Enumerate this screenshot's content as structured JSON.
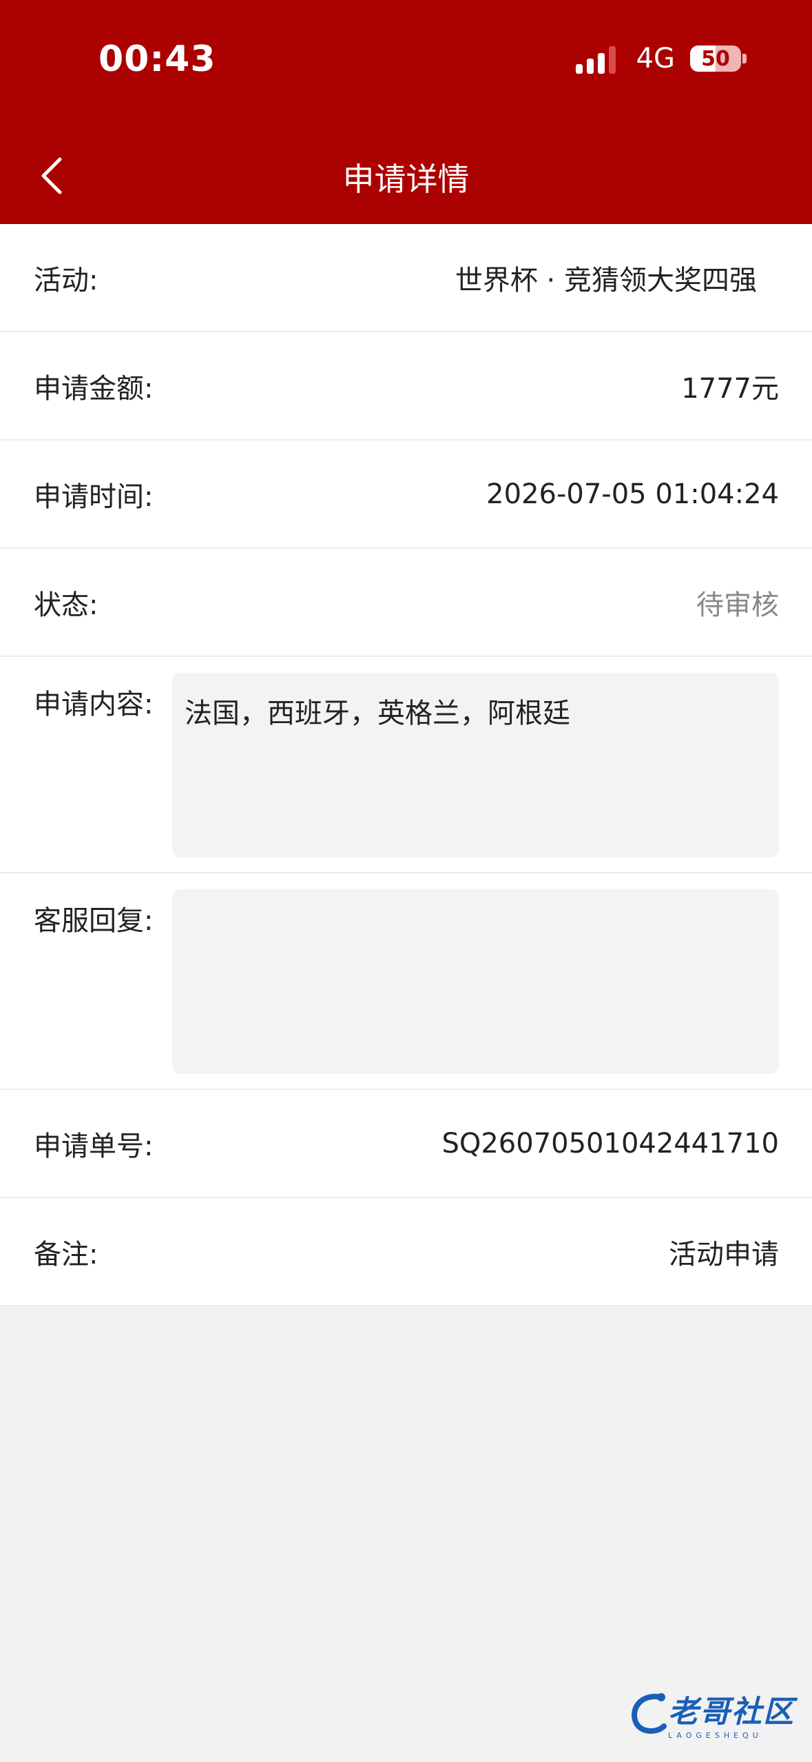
{
  "status_bar": {
    "time": "00:43",
    "network": "4G",
    "battery": "50",
    "battery_level": 0.5
  },
  "header": {
    "title": "申请详情"
  },
  "rows": [
    {
      "label": "活动:",
      "value": "世界杯 · 竞猜领大奖四强"
    },
    {
      "label": "申请金额:",
      "value": "1777元"
    },
    {
      "label": "申请时间:",
      "value": "2026-07-05 01:04:24"
    },
    {
      "label": "状态:",
      "value": "待审核"
    },
    {
      "label": "申请内容:",
      "value": "法国，西班牙，英格兰，阿根廷"
    },
    {
      "label": "客服回复:",
      "value": ""
    },
    {
      "label": "申请单号:",
      "value": "SQ26070501042441710"
    },
    {
      "label": "备注:",
      "value": "活动申请"
    }
  ],
  "watermark": {
    "text": "老哥社区",
    "sub": "LAOGESHEQU"
  },
  "colors": {
    "brand": "#ab0100",
    "background": "#f2f2f2",
    "muted": "#888888"
  }
}
